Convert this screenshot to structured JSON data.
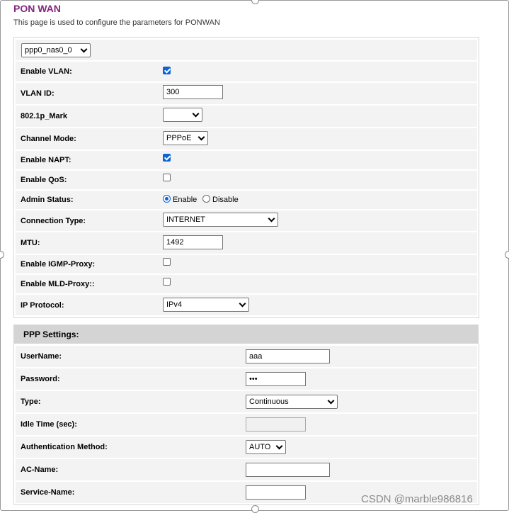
{
  "page": {
    "title": "PON WAN",
    "subtitle": "This page is used to configure the parameters for PONWAN"
  },
  "colors": {
    "title": "#84257f",
    "accent": "#0b64d6",
    "row_bg": "#f3f3f3",
    "section_bg": "#d4d4d4"
  },
  "wan": {
    "connection_select": "ppp0_nas0_0",
    "enable_vlan_label": "Enable VLAN:",
    "enable_vlan": true,
    "vlan_id_label": "VLAN ID:",
    "vlan_id": "300",
    "mark_label": "802.1p_Mark",
    "mark_value": "",
    "channel_mode_label": "Channel Mode:",
    "channel_mode": "PPPoE",
    "napt_label": "Enable NAPT:",
    "napt": true,
    "qos_label": "Enable QoS:",
    "qos": false,
    "admin_status_label": "Admin Status:",
    "admin_enable": "Enable",
    "admin_disable": "Disable",
    "admin_status": "Enable",
    "connection_type_label": "Connection Type:",
    "connection_type": "INTERNET",
    "mtu_label": "MTU:",
    "mtu": "1492",
    "igmp_label": "Enable IGMP-Proxy:",
    "igmp": false,
    "mld_label": "Enable MLD-Proxy::",
    "mld": false,
    "ip_protocol_label": "IP Protocol:",
    "ip_protocol": "IPv4"
  },
  "ppp": {
    "section_title": "PPP Settings:",
    "username_label": "UserName:",
    "username": "aaa",
    "password_label": "Password:",
    "password_masked": "•••",
    "type_label": "Type:",
    "type": "Continuous",
    "idle_label": "Idle Time (sec):",
    "idle": "",
    "auth_label": "Authentication Method:",
    "auth": "AUTO",
    "ac_name_label": "AC-Name:",
    "ac_name": "",
    "service_name_label": "Service-Name:",
    "service_name": ""
  },
  "watermark": "CSDN @marble986816"
}
